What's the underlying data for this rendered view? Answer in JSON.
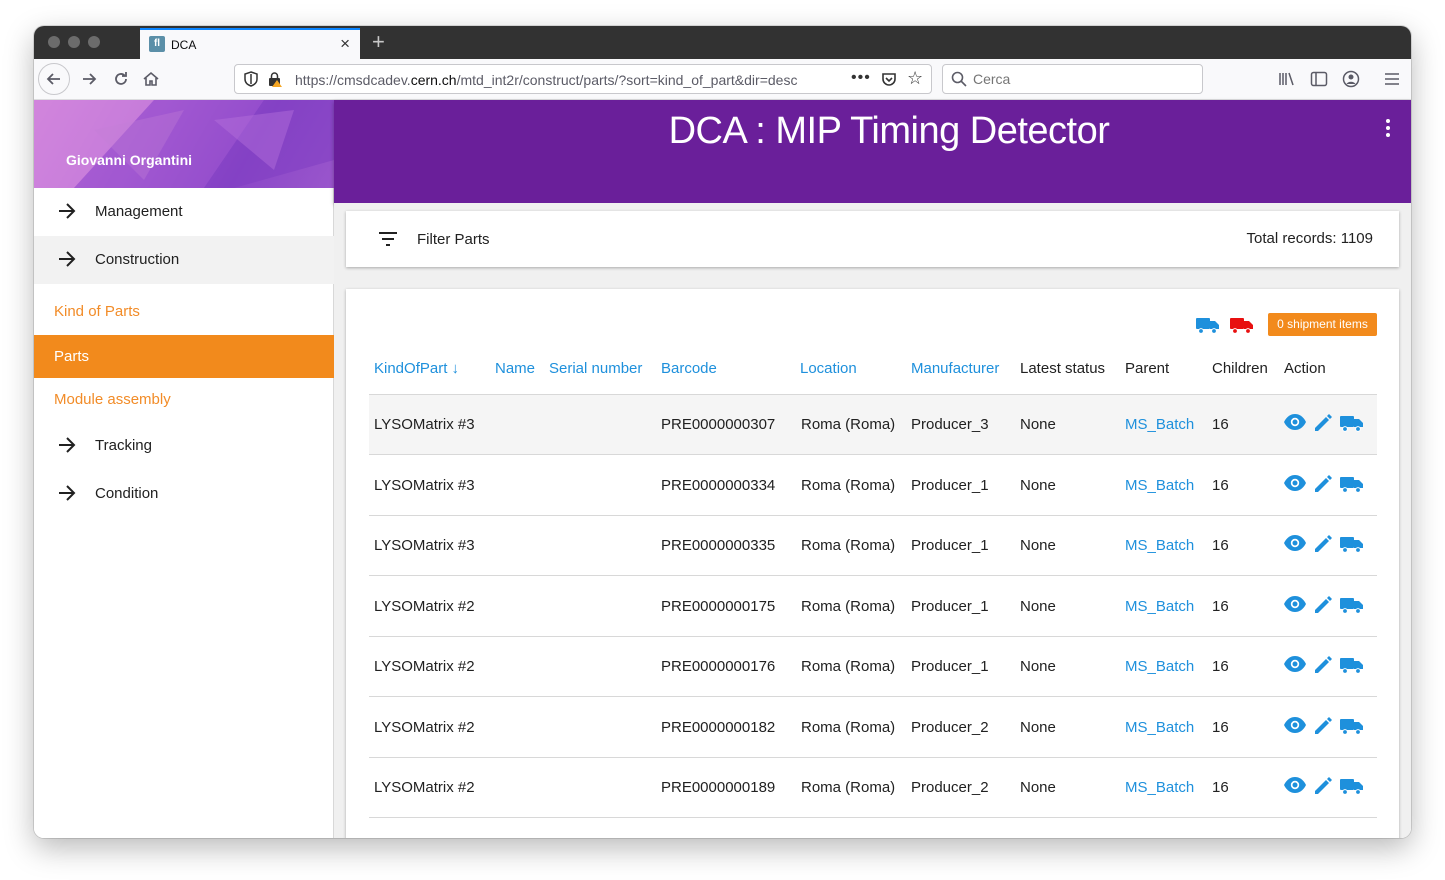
{
  "browser": {
    "tab_title": "DCA",
    "tab_favicon": "fl",
    "url_prefix": "https://cmsdcadev.",
    "url_domain": "cern.ch",
    "url_path": "/mtd_int2r/construct/parts/?sort=kind_of_part&dir=desc",
    "search_placeholder": "Cerca"
  },
  "sidebar": {
    "user": "Giovanni Organtini",
    "items": [
      {
        "label": "Management"
      },
      {
        "label": "Construction"
      }
    ],
    "sub_items": [
      {
        "label": "Kind of Parts"
      },
      {
        "label": "Parts"
      },
      {
        "label": "Module assembly"
      }
    ],
    "items2": [
      {
        "label": "Tracking"
      },
      {
        "label": "Condition"
      }
    ]
  },
  "header": {
    "title": "DCA : MIP Timing Detector"
  },
  "filter": {
    "label": "Filter Parts",
    "total": "Total records: 1109"
  },
  "table": {
    "shipment_badge": "0 shipment items",
    "columns": {
      "kindofpart": "KindOfPart ↓",
      "name": "Name",
      "serial": "Serial number",
      "barcode": "Barcode",
      "location": "Location",
      "manufacturer": "Manufacturer",
      "status": "Latest status",
      "parent": "Parent",
      "children": "Children",
      "action": "Action"
    },
    "rows": [
      {
        "kind": "LYSOMatrix #3",
        "barcode": "PRE0000000307",
        "location": "Roma (Roma)",
        "manufacturer": "Producer_3",
        "status": "None",
        "parent": "MS_Batch",
        "children": "16"
      },
      {
        "kind": "LYSOMatrix #3",
        "barcode": "PRE0000000334",
        "location": "Roma (Roma)",
        "manufacturer": "Producer_1",
        "status": "None",
        "parent": "MS_Batch",
        "children": "16"
      },
      {
        "kind": "LYSOMatrix #3",
        "barcode": "PRE0000000335",
        "location": "Roma (Roma)",
        "manufacturer": "Producer_1",
        "status": "None",
        "parent": "MS_Batch",
        "children": "16"
      },
      {
        "kind": "LYSOMatrix #2",
        "barcode": "PRE0000000175",
        "location": "Roma (Roma)",
        "manufacturer": "Producer_1",
        "status": "None",
        "parent": "MS_Batch",
        "children": "16"
      },
      {
        "kind": "LYSOMatrix #2",
        "barcode": "PRE0000000176",
        "location": "Roma (Roma)",
        "manufacturer": "Producer_1",
        "status": "None",
        "parent": "MS_Batch",
        "children": "16"
      },
      {
        "kind": "LYSOMatrix #2",
        "barcode": "PRE0000000182",
        "location": "Roma (Roma)",
        "manufacturer": "Producer_2",
        "status": "None",
        "parent": "MS_Batch",
        "children": "16"
      },
      {
        "kind": "LYSOMatrix #2",
        "barcode": "PRE0000000189",
        "location": "Roma (Roma)",
        "manufacturer": "Producer_2",
        "status": "None",
        "parent": "MS_Batch",
        "children": "16"
      }
    ]
  },
  "colors": {
    "header_purple": "#6a1f9a",
    "accent_orange": "#f28a1c",
    "link_blue": "#1e90dc",
    "truck_red": "#e81010"
  },
  "icons": {
    "row_actions": [
      "eye-icon",
      "pencil-icon",
      "truck-icon"
    ]
  }
}
